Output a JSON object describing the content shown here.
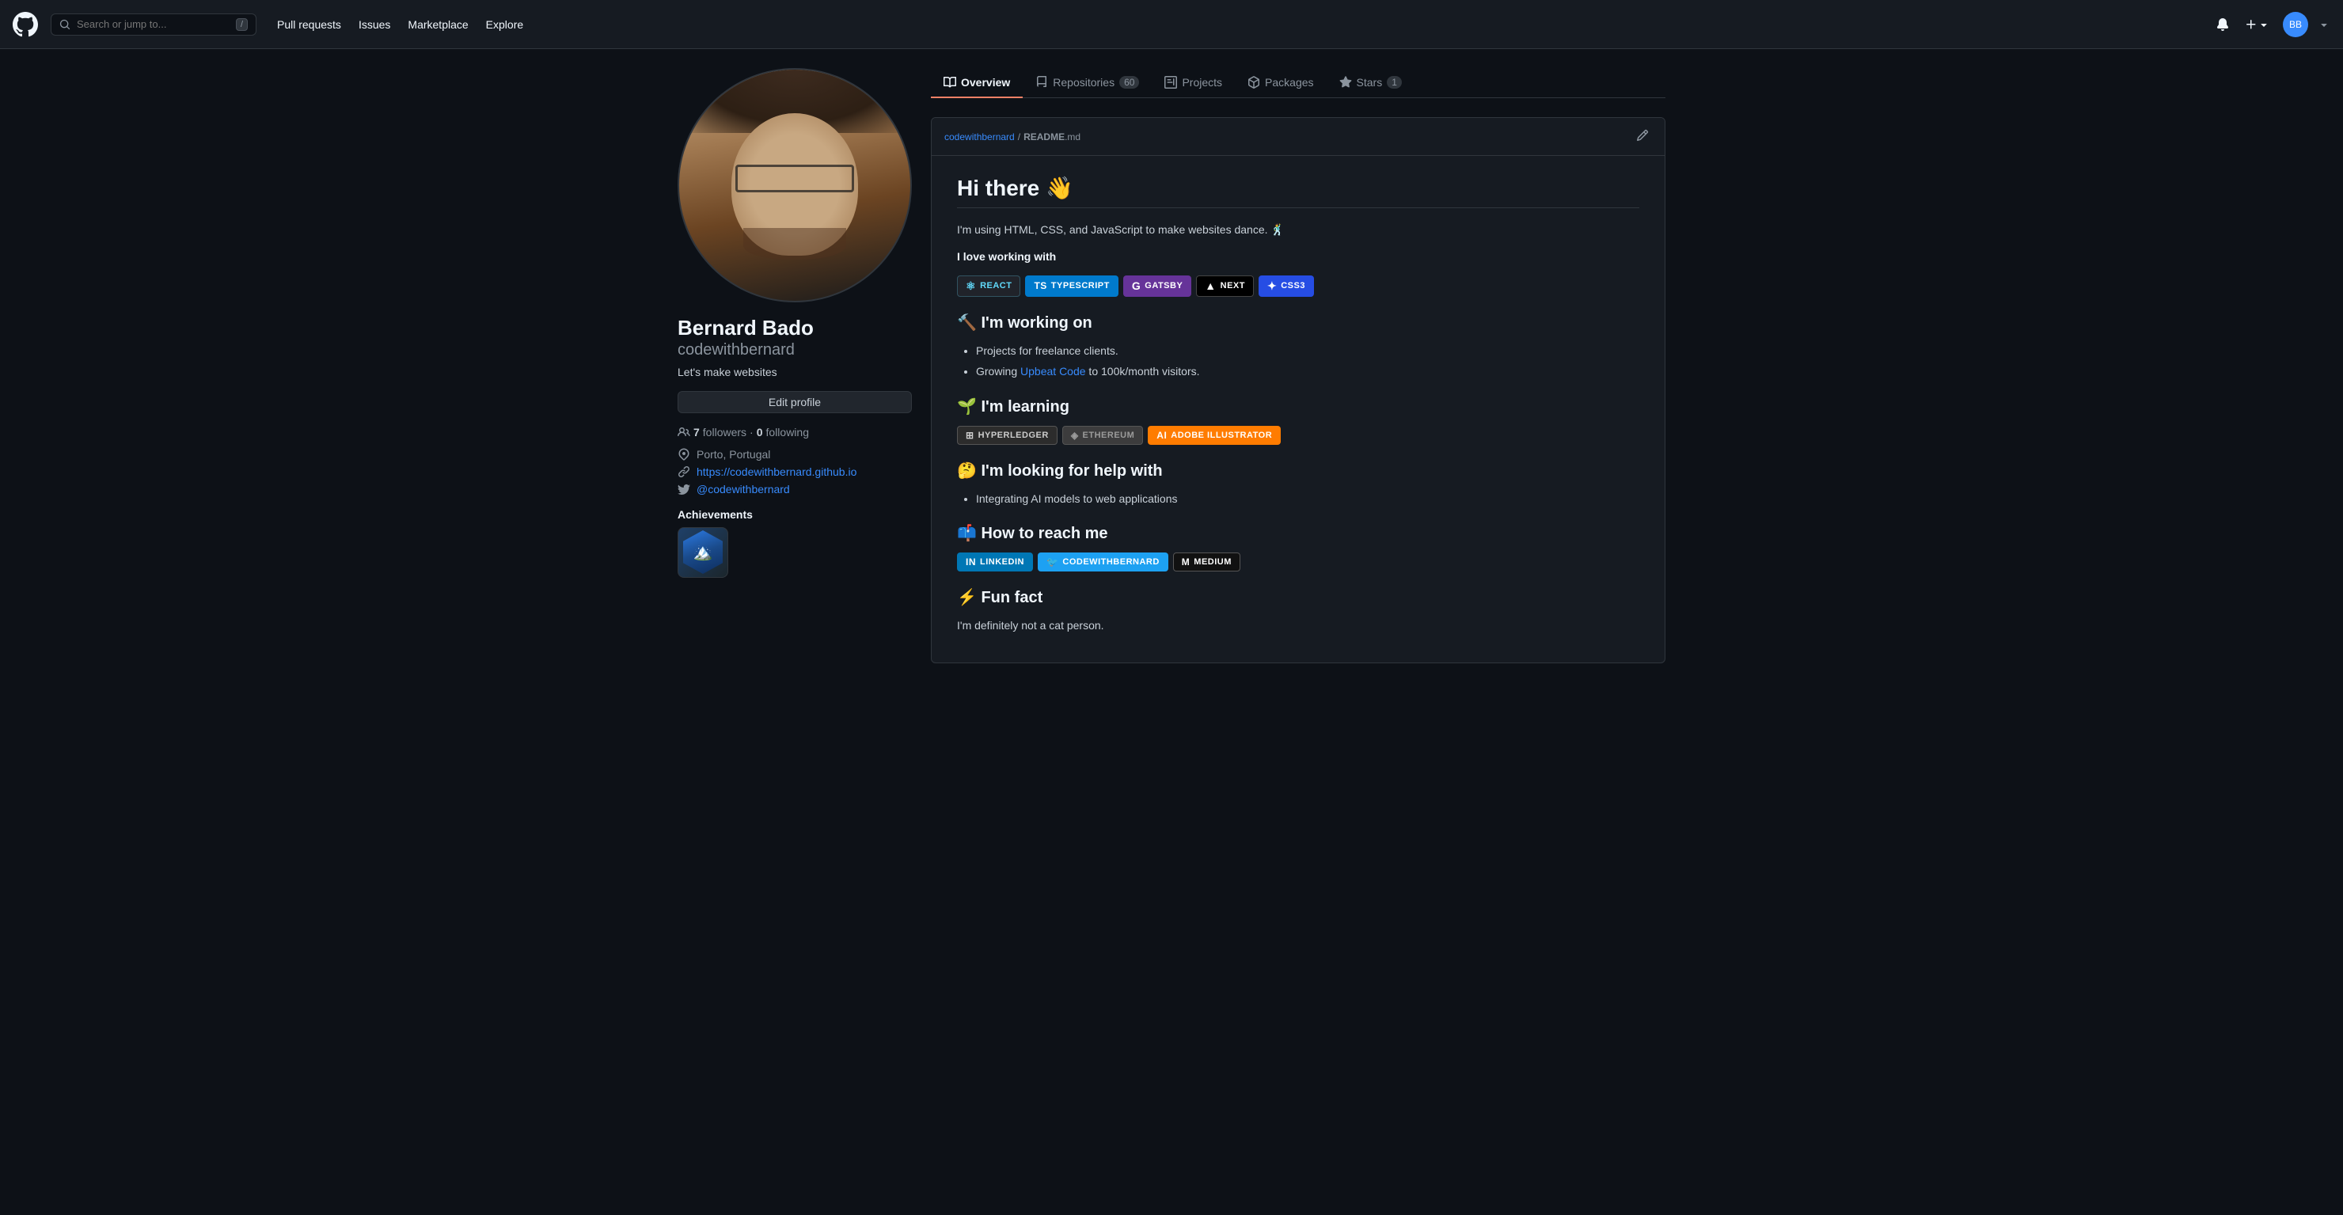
{
  "navbar": {
    "logo_alt": "GitHub",
    "search_placeholder": "Search or jump to...",
    "kbd_label": "/",
    "links": [
      {
        "label": "Pull requests",
        "id": "pull-requests"
      },
      {
        "label": "Issues",
        "id": "issues"
      },
      {
        "label": "Marketplace",
        "id": "marketplace"
      },
      {
        "label": "Explore",
        "id": "explore"
      }
    ]
  },
  "profile": {
    "name": "Bernard Bado",
    "handle": "codewithbernard",
    "bio": "Let's make websites",
    "edit_button": "Edit profile",
    "followers_count": "7",
    "followers_label": "followers",
    "following_count": "0",
    "following_label": "following",
    "location": "Porto, Portugal",
    "website": "https://codewithbernard.github.io",
    "twitter": "@codewithbernard",
    "achievements_title": "Achievements"
  },
  "tabs": [
    {
      "id": "overview",
      "label": "Overview",
      "icon": "book-icon",
      "active": true,
      "count": null
    },
    {
      "id": "repositories",
      "label": "Repositories",
      "icon": "repo-icon",
      "active": false,
      "count": "60"
    },
    {
      "id": "projects",
      "label": "Projects",
      "icon": "project-icon",
      "active": false,
      "count": null
    },
    {
      "id": "packages",
      "label": "Packages",
      "icon": "package-icon",
      "active": false,
      "count": null
    },
    {
      "id": "stars",
      "label": "Stars",
      "icon": "star-icon",
      "active": false,
      "count": "1"
    }
  ],
  "readme": {
    "breadcrumb_user": "codewithbernard",
    "breadcrumb_file": "README",
    "breadcrumb_ext": ".md",
    "title": "Hi there 👋",
    "intro": "I'm using HTML, CSS, and JavaScript to make websites dance. 🕺",
    "love_heading": "I love working with",
    "love_badges": [
      {
        "id": "react",
        "label": "REACT",
        "class": "badge-react",
        "dot": "#61dafb"
      },
      {
        "id": "typescript",
        "label": "TYPESCRIPT",
        "class": "badge-typescript",
        "dot": "#fff"
      },
      {
        "id": "gatsby",
        "label": "GATSBY",
        "class": "badge-gatsby",
        "dot": "#fff"
      },
      {
        "id": "next",
        "label": "NEXT",
        "class": "badge-next",
        "dot": "#fff"
      },
      {
        "id": "css3",
        "label": "CSS3",
        "class": "badge-css3",
        "dot": "#fff"
      }
    ],
    "working_heading": "🔨 I'm working on",
    "working_items": [
      "Projects for freelance clients.",
      "Growing Upbeat Code to 100k/month visitors."
    ],
    "upbeat_code_link": "Upbeat Code",
    "learning_heading": "🌱 I'm learning",
    "learning_badges": [
      {
        "id": "hyperledger",
        "label": "HYPERLEDGER",
        "class": "badge-hyperledger"
      },
      {
        "id": "ethereum",
        "label": "ETHEREUM",
        "class": "badge-ethereum"
      },
      {
        "id": "adobe-illustrator",
        "label": "ADOBE ILLUSTRATOR",
        "class": "badge-adobe-illustrator"
      }
    ],
    "help_heading": "🤔 I'm looking for help with",
    "help_items": [
      "Integrating AI models to web applications"
    ],
    "reach_heading": "📫 How to reach me",
    "reach_badges": [
      {
        "id": "linkedin",
        "label": "LINKEDIN",
        "class": "badge-linkedin"
      },
      {
        "id": "twitter",
        "label": "CODEWITHBERNARD",
        "class": "badge-twitter"
      },
      {
        "id": "medium",
        "label": "MEDIUM",
        "class": "badge-medium"
      }
    ],
    "funfact_heading": "⚡ Fun fact",
    "funfact_text": "I'm definitely not a cat person."
  }
}
